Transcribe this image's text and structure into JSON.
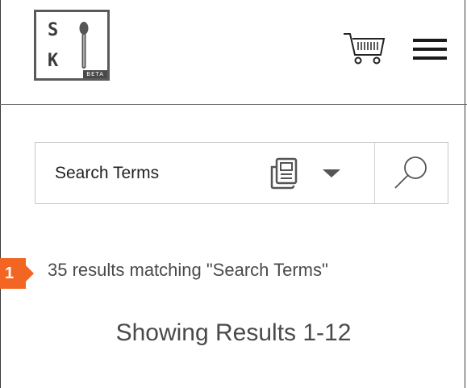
{
  "logo": {
    "letter_top": "S",
    "letter_bottom": "K",
    "badge": "BETA"
  },
  "header": {
    "cart_icon": "shopping-cart-icon",
    "menu_icon": "hamburger-menu-icon"
  },
  "search": {
    "placeholder": "Search Terms",
    "value": "",
    "type_icon": "document-icon",
    "dropdown_icon": "caret-down-icon",
    "submit_icon": "search-icon"
  },
  "results": {
    "count_text": "35 results matching \"Search Terms\"",
    "showing_text": "Showing Results 1-12"
  },
  "annotation": {
    "marker_label": "1",
    "color": "#f26522"
  }
}
